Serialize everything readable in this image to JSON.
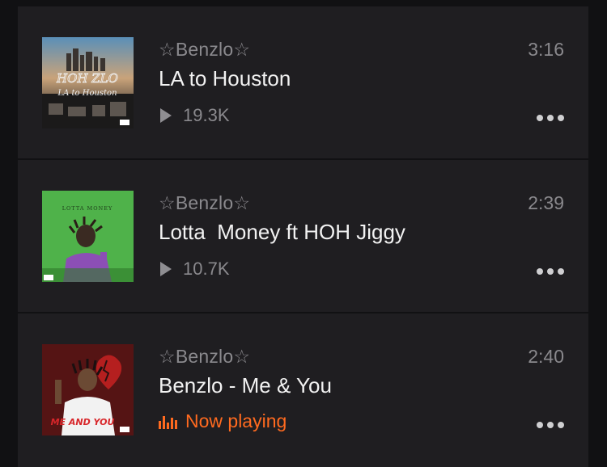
{
  "tracks": [
    {
      "artist": "☆Benzlo☆",
      "title": "LA to Houston",
      "duration": "3:16",
      "plays": "19.3K",
      "cover_text": [
        "HOH ZLO",
        "LA to Houston"
      ],
      "now_playing": false
    },
    {
      "artist": "☆Benzlo☆",
      "title": "Lotta  Money ft HOH Jiggy",
      "duration": "2:39",
      "plays": "10.7K",
      "cover_text": [
        "LOTTA MONEY"
      ],
      "now_playing": false
    },
    {
      "artist": "☆Benzlo☆",
      "title": "Benzlo - Me & You",
      "duration": "2:40",
      "status": "Now playing",
      "cover_text": [
        "ME AND YOU"
      ],
      "now_playing": true
    }
  ],
  "colors": {
    "background": "#111113",
    "card": "#1f1e21",
    "accent": "#ff6a1f",
    "muted_text": "#8a898d",
    "title_text": "#f2f2f2"
  },
  "icons": {
    "play": "play-icon",
    "more": "more-options-icon",
    "waveform": "equalizer-icon"
  }
}
